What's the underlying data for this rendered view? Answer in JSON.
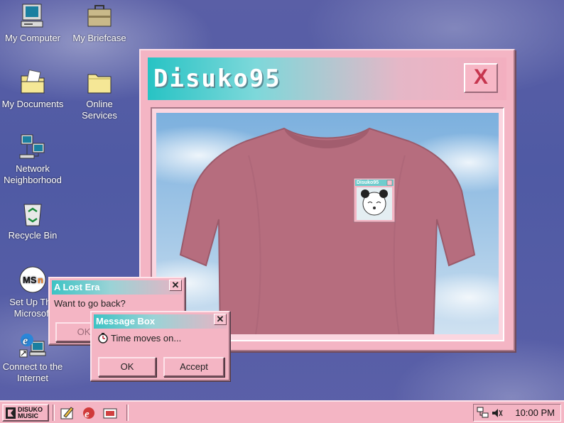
{
  "desktop": {
    "icons": [
      {
        "label": "My Computer",
        "icon": "computer-icon"
      },
      {
        "label": "My Briefcase",
        "icon": "briefcase-icon"
      },
      {
        "label": "My Documents",
        "icon": "documents-folder-icon"
      },
      {
        "label": "Online Services",
        "icon": "folder-icon"
      },
      {
        "label": "Network Neighborhood",
        "icon": "network-icon"
      },
      {
        "label": "Recycle Bin",
        "icon": "recycle-bin-icon"
      },
      {
        "label": "Set Up The Microsoft",
        "icon": "msn-icon"
      },
      {
        "label": "Connect to the Internet",
        "icon": "internet-explorer-icon"
      }
    ]
  },
  "main_window": {
    "title": "Disuko95",
    "close_label": "X",
    "mini_window_title": "Disuko95"
  },
  "lost_era_dialog": {
    "title": "A Lost Era",
    "message": "Want to go back?",
    "ok_label": "OK"
  },
  "message_box": {
    "title": "Message Box",
    "message": "Time moves on...",
    "ok_label": "OK",
    "accept_label": "Accept"
  },
  "taskbar": {
    "start_label_1": "DISUKO",
    "start_label_2": "MUSIC",
    "clock": "10:00 PM"
  },
  "colors": {
    "window_pink": "#f4b5c4",
    "titlebar_teal": "#27c3c4",
    "desktop_blue": "#5a5fa6",
    "shirt_mauve": "#b66d7e"
  }
}
